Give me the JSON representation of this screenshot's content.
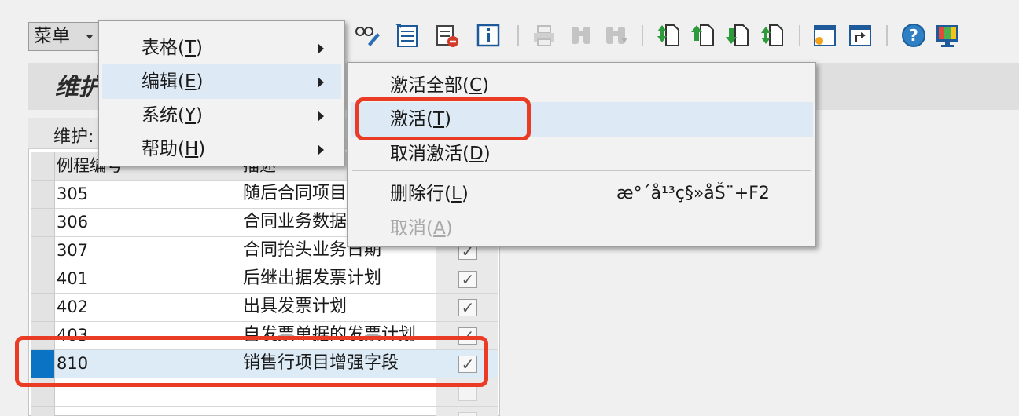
{
  "toolbar": {
    "menu_label": "菜单",
    "icons": [
      {
        "name": "glasses-pencil-icon"
      },
      {
        "name": "document-list-icon"
      },
      {
        "name": "remove-layout-icon"
      },
      {
        "name": "info-icon"
      },
      {
        "name": "print-icon"
      },
      {
        "name": "find-icon"
      },
      {
        "name": "find-next-icon"
      },
      {
        "name": "first-page-icon"
      },
      {
        "name": "previous-page-icon"
      },
      {
        "name": "next-page-icon"
      },
      {
        "name": "last-page-icon"
      },
      {
        "name": "new-session-icon"
      },
      {
        "name": "shortcut-icon"
      },
      {
        "name": "help-icon"
      },
      {
        "name": "customize-layout-icon"
      }
    ]
  },
  "title": "维护",
  "table": {
    "caption": "维护:",
    "headers": [
      "例程编号",
      "描述",
      ""
    ],
    "rows": [
      {
        "id": "305",
        "desc": "随后合同项目",
        "checked": true
      },
      {
        "id": "306",
        "desc": "合同业务数据",
        "checked": true
      },
      {
        "id": "307",
        "desc": "合同抬头业务日期",
        "checked": true
      },
      {
        "id": "401",
        "desc": "后继出据发票计划",
        "checked": true
      },
      {
        "id": "402",
        "desc": "出具发票计划",
        "checked": true
      },
      {
        "id": "403",
        "desc": "自发票单据的发票计划",
        "checked": true
      },
      {
        "id": "810",
        "desc": "销售行项目增强字段",
        "checked": true,
        "selected": true
      },
      {
        "id": "",
        "desc": "",
        "checked": false
      },
      {
        "id": "",
        "desc": "",
        "checked": false
      }
    ]
  },
  "menu": {
    "items": [
      {
        "label": "表格(",
        "key": "T",
        "suffix": ")"
      },
      {
        "label": "编辑(",
        "key": "E",
        "suffix": ")"
      },
      {
        "label": "系统(",
        "key": "Y",
        "suffix": ")"
      },
      {
        "label": "帮助(",
        "key": "H",
        "suffix": ")"
      }
    ]
  },
  "submenu": {
    "items": [
      {
        "label": "激活全部(",
        "key": "C",
        "suffix": ")"
      },
      {
        "label": "激活(",
        "key": "T",
        "suffix": ")"
      },
      {
        "label": "取消激活(",
        "key": "D",
        "suffix": ")"
      },
      {
        "label": "删除行(",
        "key": "L",
        "suffix": ")",
        "shortcut": "æ°´å¹³ç§»åŠ¨+F2"
      },
      {
        "label": "取消(",
        "key": "A",
        "suffix": ")",
        "disabled": true
      }
    ]
  },
  "colors": {
    "highlight": "#ea3b25",
    "selection": "#0a73c4",
    "hover": "#dde9f4"
  }
}
